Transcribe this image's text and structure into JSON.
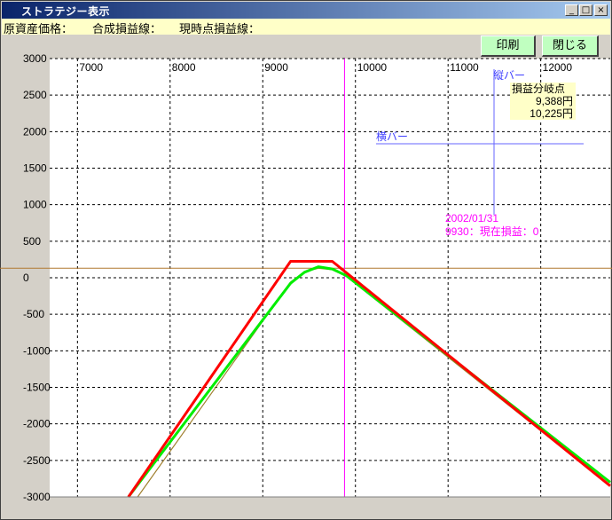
{
  "window": {
    "title": "ストラテジー表示",
    "min_label": "_",
    "max_label": "□",
    "close_label": "×"
  },
  "info": {
    "underlying_price": "原資産価格：",
    "combined_pl": "合成損益線：",
    "current_pl": "現時点損益線："
  },
  "buttons": {
    "print": "印刷",
    "close": "閉じる"
  },
  "chart_data": {
    "type": "line",
    "x_ticks": [
      "7000",
      "8000",
      "9000",
      "10000",
      "11000",
      "12000"
    ],
    "y_ticks": [
      "3000",
      "2500",
      "2000",
      "1500",
      "1000",
      "500",
      "0",
      "-500",
      "-1000",
      "-1500",
      "-2000",
      "-2500",
      "-3000"
    ],
    "xlim": [
      6700,
      12750
    ],
    "ylim": [
      -3000,
      3000
    ],
    "grid": true,
    "series": [
      {
        "color": "#ff0000",
        "points": [
          [
            7550,
            -3000
          ],
          [
            9300,
            225
          ],
          [
            9750,
            225
          ],
          [
            12750,
            -2850
          ]
        ]
      },
      {
        "color": "#00ee00",
        "points": [
          [
            7550,
            -3000
          ],
          [
            9300,
            -75
          ],
          [
            9450,
            75
          ],
          [
            9600,
            150
          ],
          [
            9750,
            120
          ],
          [
            9900,
            30
          ],
          [
            12750,
            -2800
          ]
        ]
      },
      {
        "color": "#a08030",
        "points": [
          [
            7650,
            -3000
          ],
          [
            9300,
            -60
          ],
          [
            9450,
            80
          ],
          [
            9600,
            130
          ],
          [
            9750,
            110
          ],
          [
            9900,
            20
          ],
          [
            12750,
            -2850
          ]
        ]
      }
    ],
    "current_line": {
      "y": 130,
      "color": "#b07830"
    },
    "cursor_x": 9930,
    "annotations": {
      "vbar_label": "縦バー",
      "hbar_label": "横バー",
      "breakeven_title": "損益分岐点",
      "breakeven_1": "9,388円",
      "breakeven_2": "10,225円",
      "cursor_date": "2002/01/31",
      "cursor_info": "9930：現在損益：0"
    }
  }
}
